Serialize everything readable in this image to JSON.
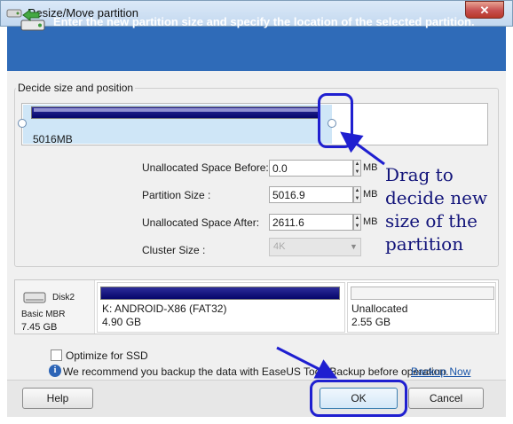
{
  "window": {
    "title": "Resize/Move partition",
    "close_icon": "close-icon"
  },
  "header": {
    "text": "Enter the new partition size and specify the location of the selected partition.",
    "icon": "partition-resize-icon"
  },
  "size_group": {
    "label": "Decide size and position",
    "partition_size_readout": "5016MB",
    "fields": [
      {
        "label": "Unallocated Space Before:",
        "value": "0.0",
        "unit": "MB"
      },
      {
        "label": "Partition Size :",
        "value": "5016.9",
        "unit": "MB"
      },
      {
        "label": "Unallocated Space After:",
        "value": "2611.6",
        "unit": "MB"
      }
    ],
    "cluster": {
      "label": "Cluster Size :",
      "value": "4K"
    }
  },
  "disk_map": {
    "disk_name": "Disk2",
    "disk_type": "Basic MBR",
    "disk_size": "7.45 GB",
    "volumes": [
      {
        "name": "K: ANDROID-X86 (FAT32)",
        "size": "4.90 GB"
      },
      {
        "name": "Unallocated",
        "size": "2.55 GB"
      }
    ]
  },
  "options": {
    "ssd_label": "Optimize for SSD",
    "ssd_checked": false,
    "recommend_text": "We recommend you backup the data with EaseUS Todo Backup before operation.",
    "backup_link": "Backup Now"
  },
  "buttons": {
    "help": "Help",
    "ok": "OK",
    "cancel": "Cancel"
  },
  "annotation": {
    "text": "Drag to decide new size of the partition",
    "color": "#12147a"
  },
  "colors": {
    "header_band": "#2f6bb8",
    "partition_bar": "#05056a",
    "annotation_ring": "#1f1fd0"
  }
}
